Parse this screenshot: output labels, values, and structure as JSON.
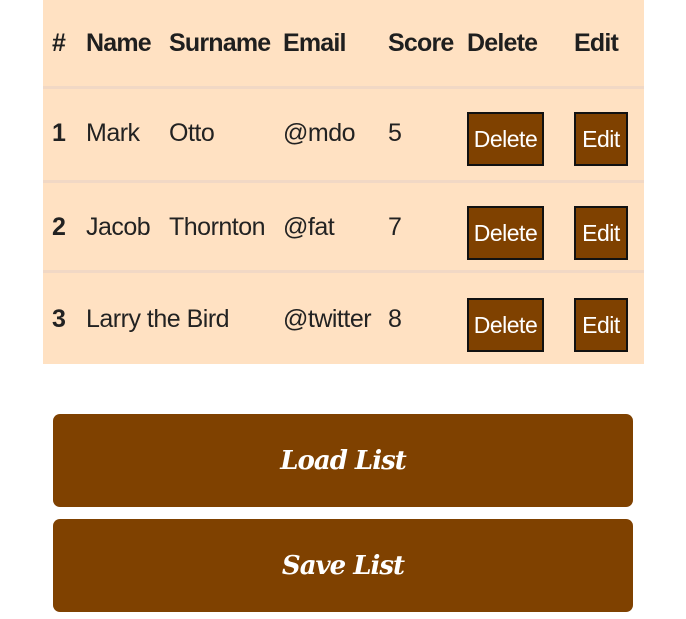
{
  "table": {
    "headers": {
      "num": "#",
      "name": "Name",
      "surname": "Surname",
      "email": "Email",
      "score": "Score",
      "delete": "Delete",
      "edit": "Edit"
    },
    "rows": [
      {
        "num": "1",
        "name": "Mark",
        "surname": "Otto",
        "email": "@mdo",
        "score": "5",
        "delete_label": "Delete",
        "edit_label": "Edit"
      },
      {
        "num": "2",
        "name": "Jacob",
        "surname": "Thornton",
        "email": "@fat",
        "score": "7",
        "delete_label": "Delete",
        "edit_label": "Edit"
      },
      {
        "num": "3",
        "name": "Larry the Bird",
        "surname": "",
        "email": "@twitter",
        "score": "8",
        "delete_label": "Delete",
        "edit_label": "Edit"
      }
    ]
  },
  "actions": {
    "load_label": "Load List",
    "save_label": "Save List"
  },
  "colors": {
    "table_background": "#ffe1c2",
    "button_brown": "#7f4100",
    "button_border": "#111111",
    "button_text": "#ffffff"
  }
}
